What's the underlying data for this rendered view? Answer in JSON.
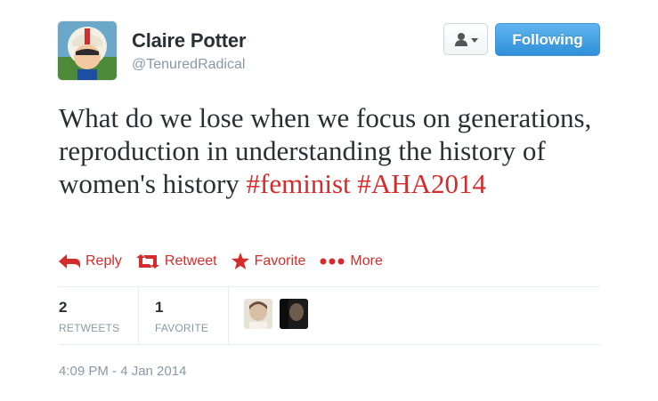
{
  "user": {
    "name": "Claire Potter",
    "handle": "@TenuredRadical"
  },
  "buttons": {
    "follow_label": "Following"
  },
  "tweet": {
    "text_plain": "What do we lose when we focus on generations, reproduction in understanding the history of women's history",
    "hashtags": [
      "#feminist",
      "#AHA2014"
    ]
  },
  "actions": [
    {
      "label": "Reply",
      "icon": "reply-arrow"
    },
    {
      "label": "Retweet",
      "icon": "retweet-arrows"
    },
    {
      "label": "Favorite",
      "icon": "star"
    },
    {
      "label": "More",
      "icon": "three-dots"
    }
  ],
  "stats": {
    "retweets": {
      "count": "2",
      "label": "RETWEETS"
    },
    "favorites": {
      "count": "1",
      "label": "FAVORITE"
    }
  },
  "timestamp": "4:09 PM - 4 Jan 2014",
  "colors": {
    "accent_red": "#d62b2b",
    "follow_blue": "#2f8fd8",
    "muted": "#8899a6"
  }
}
